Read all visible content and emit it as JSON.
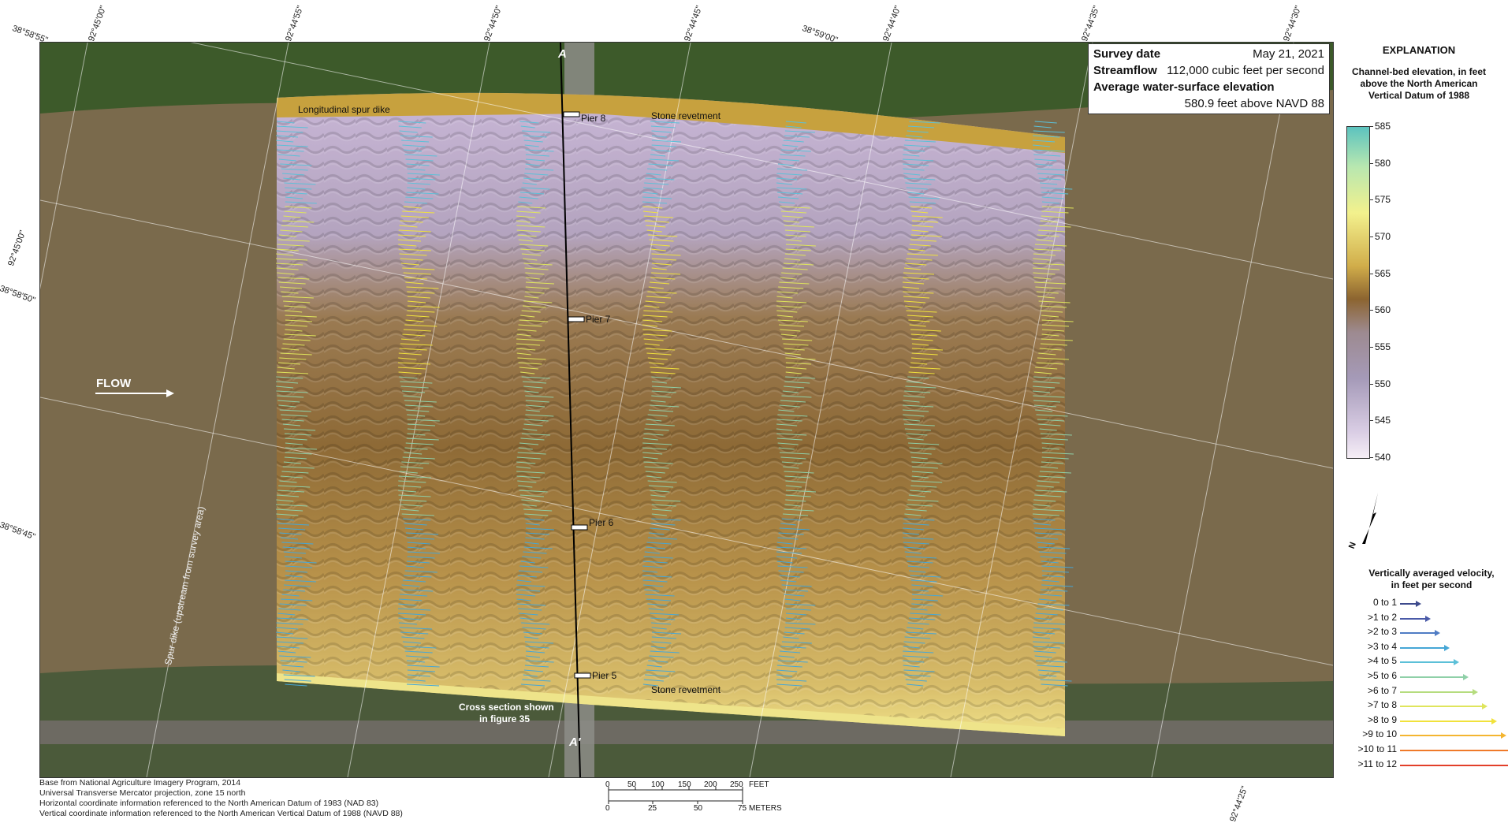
{
  "info": {
    "survey_date_label": "Survey date",
    "survey_date_value": "May 21, 2021",
    "streamflow_label": "Streamflow",
    "streamflow_value": "112,000 cubic feet per second",
    "wse_label": "Average water-surface elevation",
    "wse_value": "580.9 feet above NAVD 88"
  },
  "map_labels": {
    "longitudinal_dike": "Longitudinal spur dike",
    "stone_revetment_top": "Stone revetment",
    "stone_revetment_bottom": "Stone revetment",
    "pier8": "Pier 8",
    "pier7": "Pier 7",
    "pier6": "Pier 6",
    "pier5": "Pier 5",
    "flow": "FLOW",
    "spur_dike": "Spur dike (upstream from survey area)",
    "cross_section": "Cross section shown",
    "cross_section_2": "in figure 35",
    "section_a": "A",
    "section_a_prime": "A′"
  },
  "coord_labels": {
    "top1": "38°58'55\"",
    "top2": "92°45'00\"",
    "top3": "92°44'55\"",
    "top4": "92°44'50\"",
    "top5": "92°44'45\"",
    "top6": "38°59'00\"",
    "top7": "92°44'40\"",
    "top8": "92°44'35\"",
    "top9": "92°44'30\"",
    "left1": "92°45'00\"",
    "left2": "38°58'50\"",
    "left3": "38°58'45\"",
    "bottom1": "92°44'25\""
  },
  "credits": [
    "Base from National Agriculture Imagery Program, 2014",
    "Universal Transverse Mercator projection, zone 15 north",
    "Horizontal coordinate information referenced to the North American Datum of 1983 (NAD 83)",
    "Vertical coordinate information referenced to the North American Vertical Datum of 1988 (NAVD 88)"
  ],
  "scale": {
    "feet_ticks": [
      "0",
      "50",
      "100",
      "150",
      "200",
      "250"
    ],
    "feet_unit": "FEET",
    "meter_ticks": [
      "0",
      "25",
      "50",
      "75"
    ],
    "meter_unit": "METERS"
  },
  "legend": {
    "title": "EXPLANATION",
    "elevation_title_1": "Channel-bed elevation, in feet",
    "elevation_title_2": "above the North American",
    "elevation_title_3": "Vertical Datum of 1988",
    "elevation_ticks": [
      "585",
      "580",
      "575",
      "570",
      "565",
      "560",
      "555",
      "550",
      "545",
      "540"
    ],
    "north_letter": "N",
    "velocity_title_1": "Vertically averaged velocity,",
    "velocity_title_2": "in feet per second",
    "velocity_classes": [
      {
        "label": "0 to 1",
        "color": "#3d4a8c"
      },
      {
        "label": ">1 to 2",
        "color": "#4a5aa8"
      },
      {
        "label": ">2 to 3",
        "color": "#4f7cc4"
      },
      {
        "label": ">3 to 4",
        "color": "#46a7d6"
      },
      {
        "label": ">4 to 5",
        "color": "#5cc0d8"
      },
      {
        "label": ">5 to 6",
        "color": "#8fd0a8"
      },
      {
        "label": ">6 to 7",
        "color": "#b5dc7e"
      },
      {
        "label": ">7 to 8",
        "color": "#dfe55c"
      },
      {
        "label": ">8 to 9",
        "color": "#f1e23c"
      },
      {
        "label": ">9 to 10",
        "color": "#f4b531"
      },
      {
        "label": ">10 to 11",
        "color": "#ef7a2a"
      },
      {
        "label": ">11 to 12",
        "color": "#e2402a"
      }
    ]
  }
}
